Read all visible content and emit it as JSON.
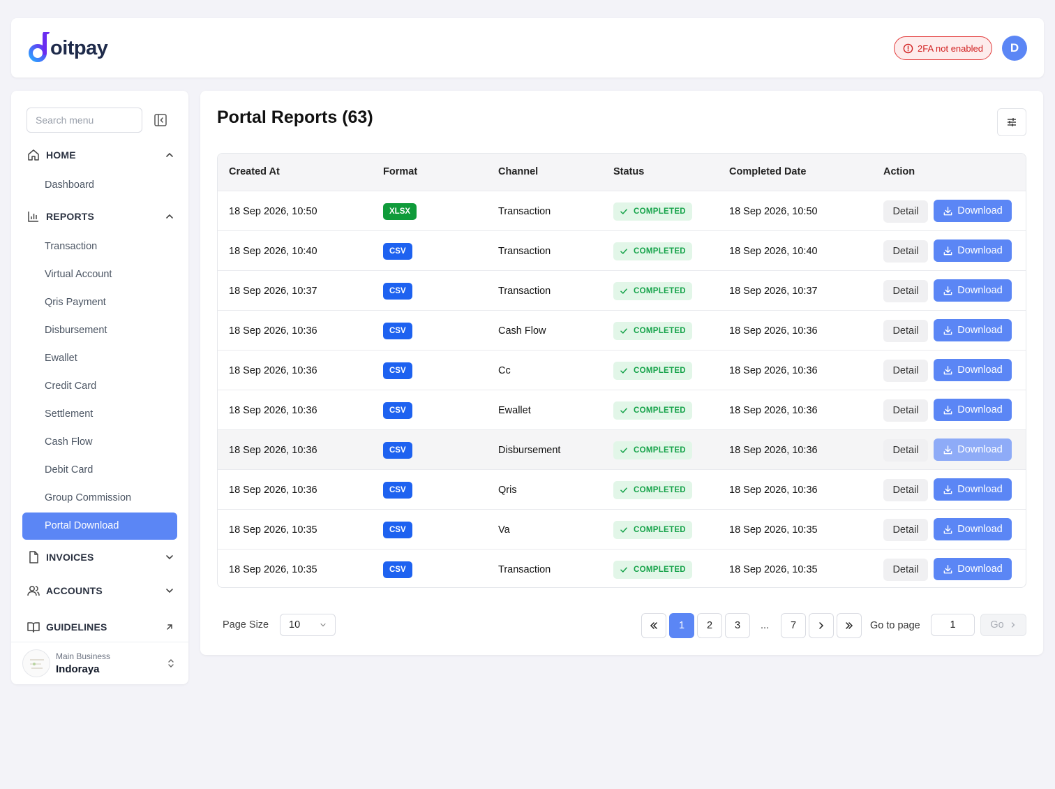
{
  "header": {
    "logo_text": "oitpay",
    "twofa_badge": "2FA not enabled",
    "avatar_initial": "D"
  },
  "sidebar": {
    "search_placeholder": "Search menu",
    "sections": {
      "home": {
        "label": "HOME",
        "items": [
          "Dashboard"
        ]
      },
      "reports": {
        "label": "REPORTS",
        "items": [
          "Transaction",
          "Virtual Account",
          "Qris Payment",
          "Disbursement",
          "Ewallet",
          "Credit Card",
          "Settlement",
          "Cash Flow",
          "Debit Card",
          "Group Commission",
          "Portal Download"
        ]
      },
      "invoices": {
        "label": "INVOICES"
      },
      "accounts": {
        "label": "ACCOUNTS"
      },
      "guidelines": {
        "label": "GUIDELINES"
      }
    },
    "business": {
      "label": "Main Business",
      "name": "Indoraya"
    }
  },
  "main": {
    "title": "Portal Reports (63)",
    "columns": [
      "Created At",
      "Format",
      "Channel",
      "Status",
      "Completed Date",
      "Action"
    ],
    "rows": [
      {
        "created": "18 Sep 2026, 10:50",
        "format": "XLSX",
        "channel": "Transaction",
        "status": "COMPLETED",
        "completed": "18 Sep 2026, 10:50"
      },
      {
        "created": "18 Sep 2026, 10:40",
        "format": "CSV",
        "channel": "Transaction",
        "status": "COMPLETED",
        "completed": "18 Sep 2026, 10:40"
      },
      {
        "created": "18 Sep 2026, 10:37",
        "format": "CSV",
        "channel": "Transaction",
        "status": "COMPLETED",
        "completed": "18 Sep 2026, 10:37"
      },
      {
        "created": "18 Sep 2026, 10:36",
        "format": "CSV",
        "channel": "Cash Flow",
        "status": "COMPLETED",
        "completed": "18 Sep 2026, 10:36"
      },
      {
        "created": "18 Sep 2026, 10:36",
        "format": "CSV",
        "channel": "Cc",
        "status": "COMPLETED",
        "completed": "18 Sep 2026, 10:36"
      },
      {
        "created": "18 Sep 2026, 10:36",
        "format": "CSV",
        "channel": "Ewallet",
        "status": "COMPLETED",
        "completed": "18 Sep 2026, 10:36"
      },
      {
        "created": "18 Sep 2026, 10:36",
        "format": "CSV",
        "channel": "Disbursement",
        "status": "COMPLETED",
        "completed": "18 Sep 2026, 10:36"
      },
      {
        "created": "18 Sep 2026, 10:36",
        "format": "CSV",
        "channel": "Qris",
        "status": "COMPLETED",
        "completed": "18 Sep 2026, 10:36"
      },
      {
        "created": "18 Sep 2026, 10:35",
        "format": "CSV",
        "channel": "Va",
        "status": "COMPLETED",
        "completed": "18 Sep 2026, 10:35"
      },
      {
        "created": "18 Sep 2026, 10:35",
        "format": "CSV",
        "channel": "Transaction",
        "status": "COMPLETED",
        "completed": "18 Sep 2026, 10:35"
      }
    ],
    "actions": {
      "detail": "Detail",
      "download": "Download"
    },
    "pagination": {
      "page_size_label": "Page Size",
      "page_size": "10",
      "pages": [
        "1",
        "2",
        "3"
      ],
      "ellipsis": "...",
      "last_page": "7",
      "goto_label": "Go to page",
      "goto_value": "1",
      "go_label": "Go"
    }
  },
  "colors": {
    "accent": "#5b86f5",
    "csv": "#1e62f0",
    "xlsx": "#0f9b3a",
    "success": "#16a34a",
    "danger": "#d11f1f"
  }
}
